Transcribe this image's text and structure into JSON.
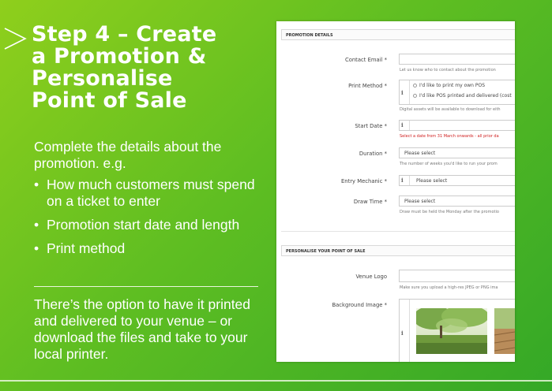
{
  "slide": {
    "title_lines": [
      "Step 4 – Create",
      "a Promotion &",
      "Personalise",
      "Point of Sale"
    ],
    "intro": "Complete the details about the promotion. e.g.",
    "bullets": [
      "How much customers must spend on a ticket to enter",
      "Promotion start date and length",
      "Print method"
    ],
    "bullet_glyph": "•",
    "outro": "There’s the option to have it printed and delivered to your venue – or download the files and take to your local printer.",
    "colors": {
      "gradient_start": "#8fcf1c",
      "gradient_end": "#34a827",
      "text": "#ffffff",
      "required_hint": "#d02020"
    }
  },
  "form": {
    "section1_title": "PROMOTION DETAILS",
    "contact_email": {
      "label": "Contact Email *",
      "value": "",
      "help": "Let us know who to contact about the promotion"
    },
    "print_method": {
      "label": "Print Method *",
      "info": "i",
      "options": [
        "I'd like to print my own POS",
        "I'd like POS printed and delivered (cost"
      ],
      "help": "Digital assets will be available to download for eith"
    },
    "start_date": {
      "label": "Start Date *",
      "info": "i",
      "value": "",
      "help": "Select a date from 31 March onwards - all prior da"
    },
    "duration": {
      "label": "Duration *",
      "value": "Please select",
      "help": "The number of weeks you'd like to run your prom"
    },
    "entry_mechanic": {
      "label": "Entry Mechanic *",
      "info": "i",
      "value": "Please select"
    },
    "draw_time": {
      "label": "Draw Time *",
      "value": "Please select",
      "help": "Draw must be held the Monday after the promotio"
    },
    "section2_title": "PERSONALISE YOUR POINT OF SALE",
    "venue_logo": {
      "label": "Venue Logo",
      "value": "",
      "help": "Make sure you upload a high-res JPEG or PNG ima"
    },
    "background_image": {
      "label": "Background Image *",
      "info": "i"
    }
  }
}
